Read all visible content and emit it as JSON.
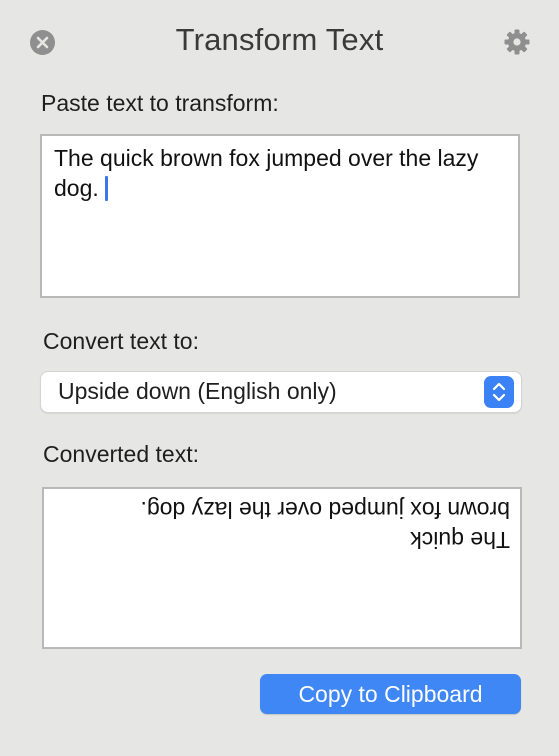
{
  "window": {
    "title": "Transform Text"
  },
  "icons": {
    "close": "close-icon",
    "settings": "gear-icon",
    "select": "chevron-up-down-icon"
  },
  "input": {
    "label": "Paste text to transform:",
    "value": "The quick brown fox jumped over the lazy dog."
  },
  "convert": {
    "label": "Convert text to:",
    "selected": "Upside down (English only)"
  },
  "output": {
    "label": "Converted text:",
    "lines": [
      "The quick",
      "brown fox jumped over the lazy dog."
    ]
  },
  "copy_button": {
    "label": "Copy to Clipboard"
  },
  "colors": {
    "accent": "#3f87f5",
    "background": "#e6e7e4",
    "caret": "#3b78e7"
  }
}
